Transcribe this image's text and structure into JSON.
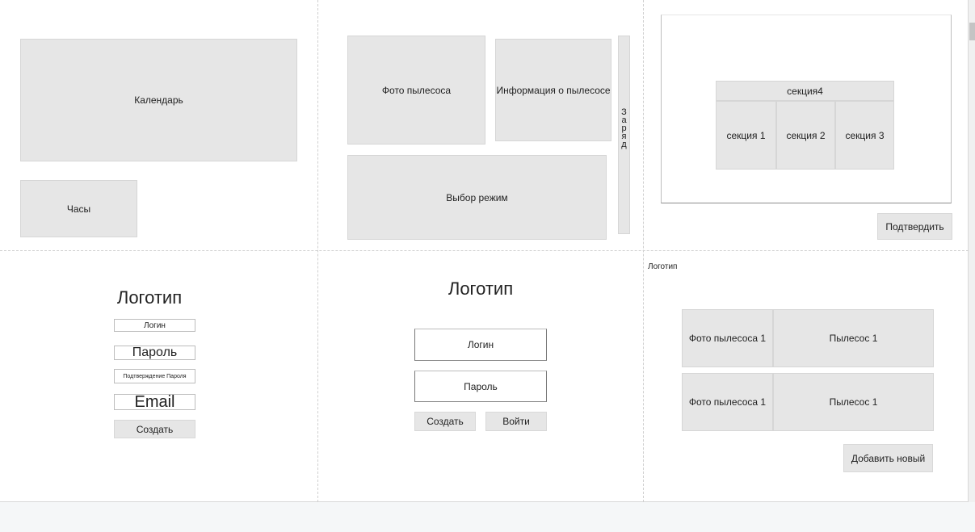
{
  "screen1": {
    "calendar_label": "Календарь",
    "clock_label": "Часы"
  },
  "screen2": {
    "photo_label": "Фото пылесоса",
    "info_label": "Информация о пылесосе",
    "mode_label": "Выбор режим",
    "charge_label": "Заряд"
  },
  "screen3": {
    "section4": "секция4",
    "section1": "секция 1",
    "section2": "секция 2",
    "section3": "секция 3",
    "confirm_button": "Подтвердить"
  },
  "screen4": {
    "logo": "Логотип",
    "login_field": "Логин",
    "password_field": "Пароль",
    "confirm_password_field": "Подтверждение Пароля",
    "email_field": "Email",
    "create_button": "Создать"
  },
  "screen5": {
    "logo": "Логотип",
    "login_field": "Логин",
    "password_field": "Пароль",
    "create_button": "Создать",
    "login_button": "Войти"
  },
  "screen6": {
    "logo": "Логотип",
    "devices": [
      {
        "photo": "Фото пылесоса 1",
        "name": "Пылесос 1"
      },
      {
        "photo": "Фото пылесоса 1",
        "name": "Пылесос 1"
      }
    ],
    "add_button": "Добавить новый"
  }
}
